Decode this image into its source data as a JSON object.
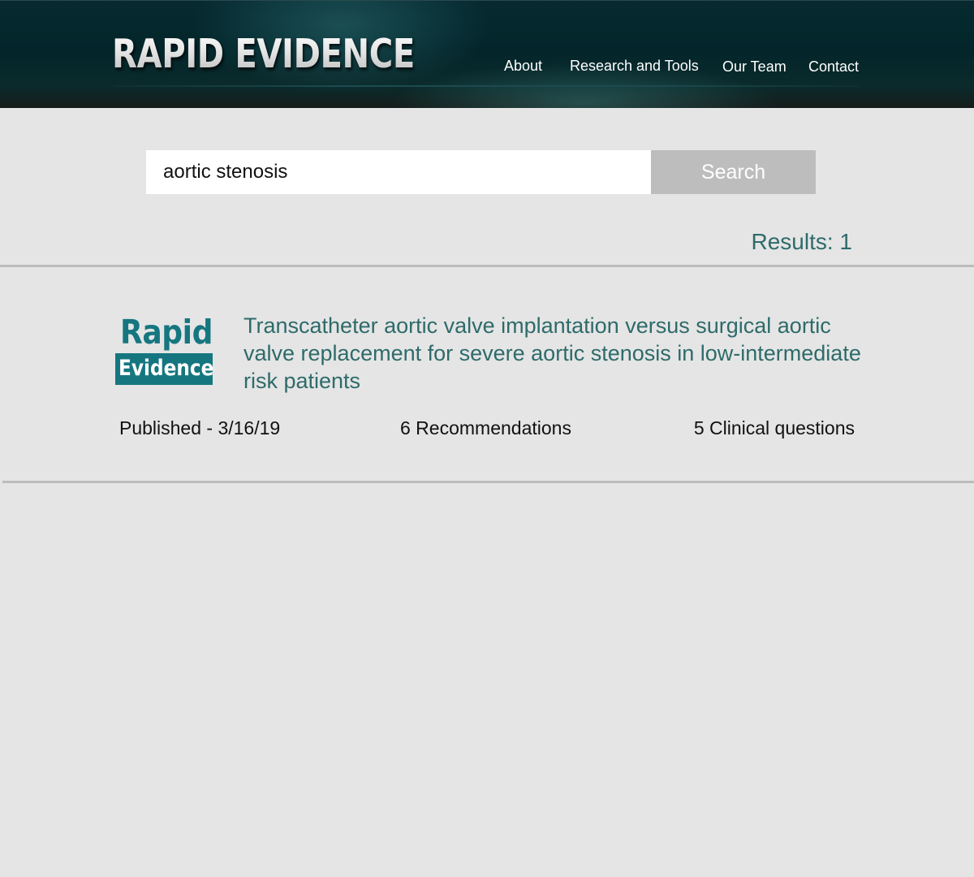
{
  "header": {
    "brand": "RAPID EVIDENCE",
    "nav": [
      {
        "label": "About"
      },
      {
        "label": "Research and Tools"
      },
      {
        "label": "Our Team"
      },
      {
        "label": "Contact"
      }
    ]
  },
  "search": {
    "value": "aortic stenosis",
    "button_label": "Search"
  },
  "results": {
    "count_label": "Results: 1",
    "items": [
      {
        "logo_line1": "Rapid",
        "logo_line2": "Evidence",
        "title": "Transcatheter aortic valve implantation versus surgical aortic valve replacement for severe aortic stenosis in low-intermediate risk patients",
        "published": "Published - 3/16/19",
        "recommendations": "6 Recommendations",
        "clinical_questions": "5 Clinical questions"
      }
    ]
  },
  "colors": {
    "page_background": "#e5e5e5",
    "header_background": "#03262b",
    "accent_teal": "#157680",
    "result_text_teal": "#2e6b6a",
    "search_button": "#bdbdbd",
    "divider": "#bcbcbc"
  }
}
